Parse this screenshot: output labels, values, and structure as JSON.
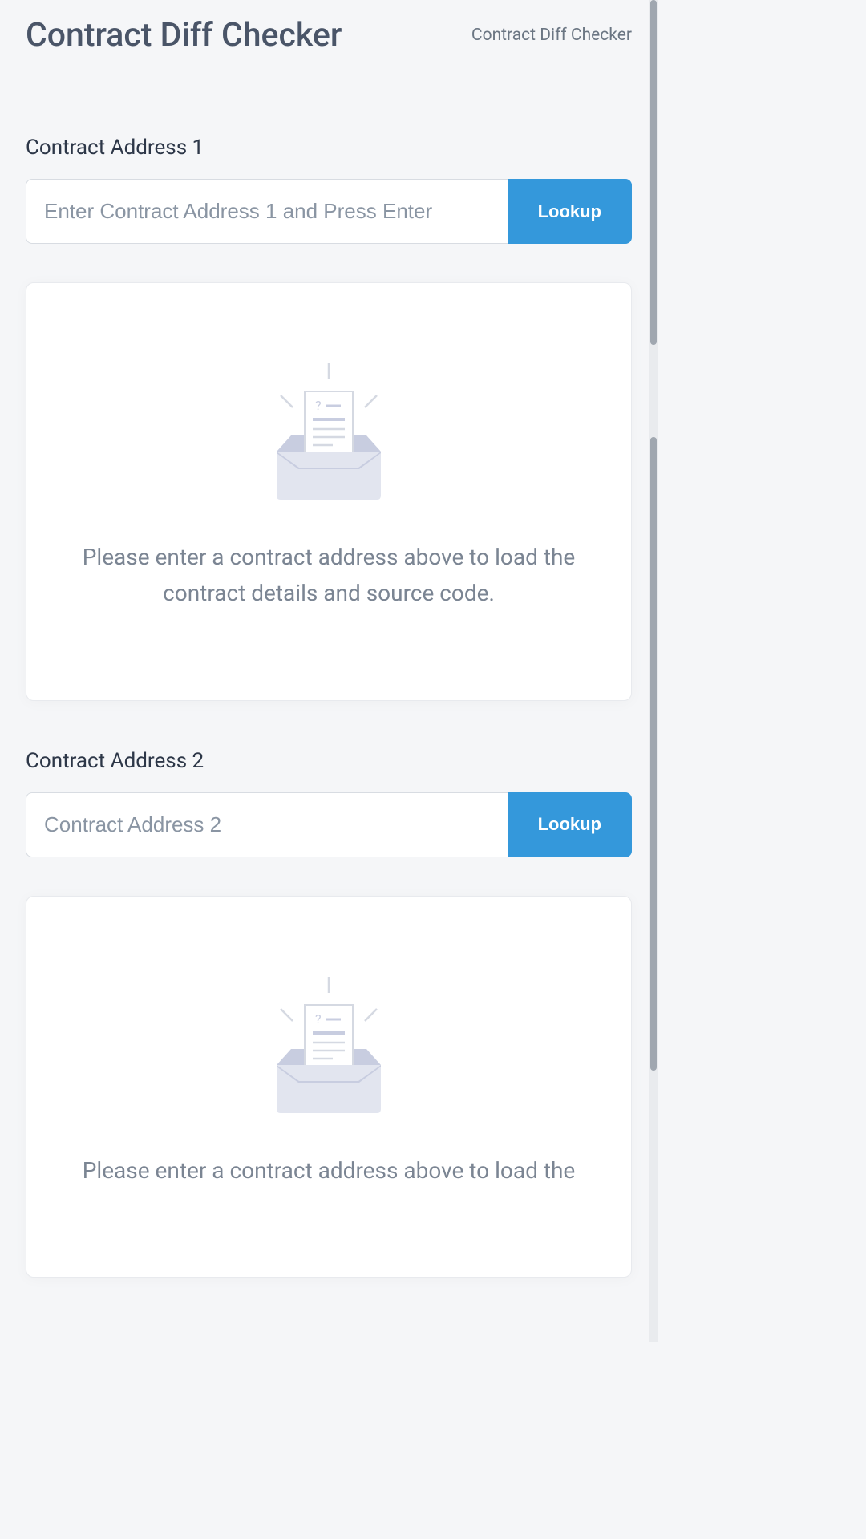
{
  "header": {
    "title": "Contract Diff Checker",
    "breadcrumb": "Contract Diff Checker"
  },
  "contract1": {
    "label": "Contract Address 1",
    "placeholder": "Enter Contract Address 1 and Press Enter",
    "lookup_button": "Lookup",
    "empty_message": "Please enter a contract address above to load the contract details and source code."
  },
  "contract2": {
    "label": "Contract Address 2",
    "placeholder": "Contract Address 2",
    "lookup_button": "Lookup",
    "empty_message": "Please enter a contract address above to load the"
  },
  "colors": {
    "primary": "#3498db",
    "background": "#f5f6f8",
    "card": "#ffffff",
    "border": "#d8dce2",
    "text_heading": "#4a5568",
    "text_muted": "#7b8593"
  }
}
